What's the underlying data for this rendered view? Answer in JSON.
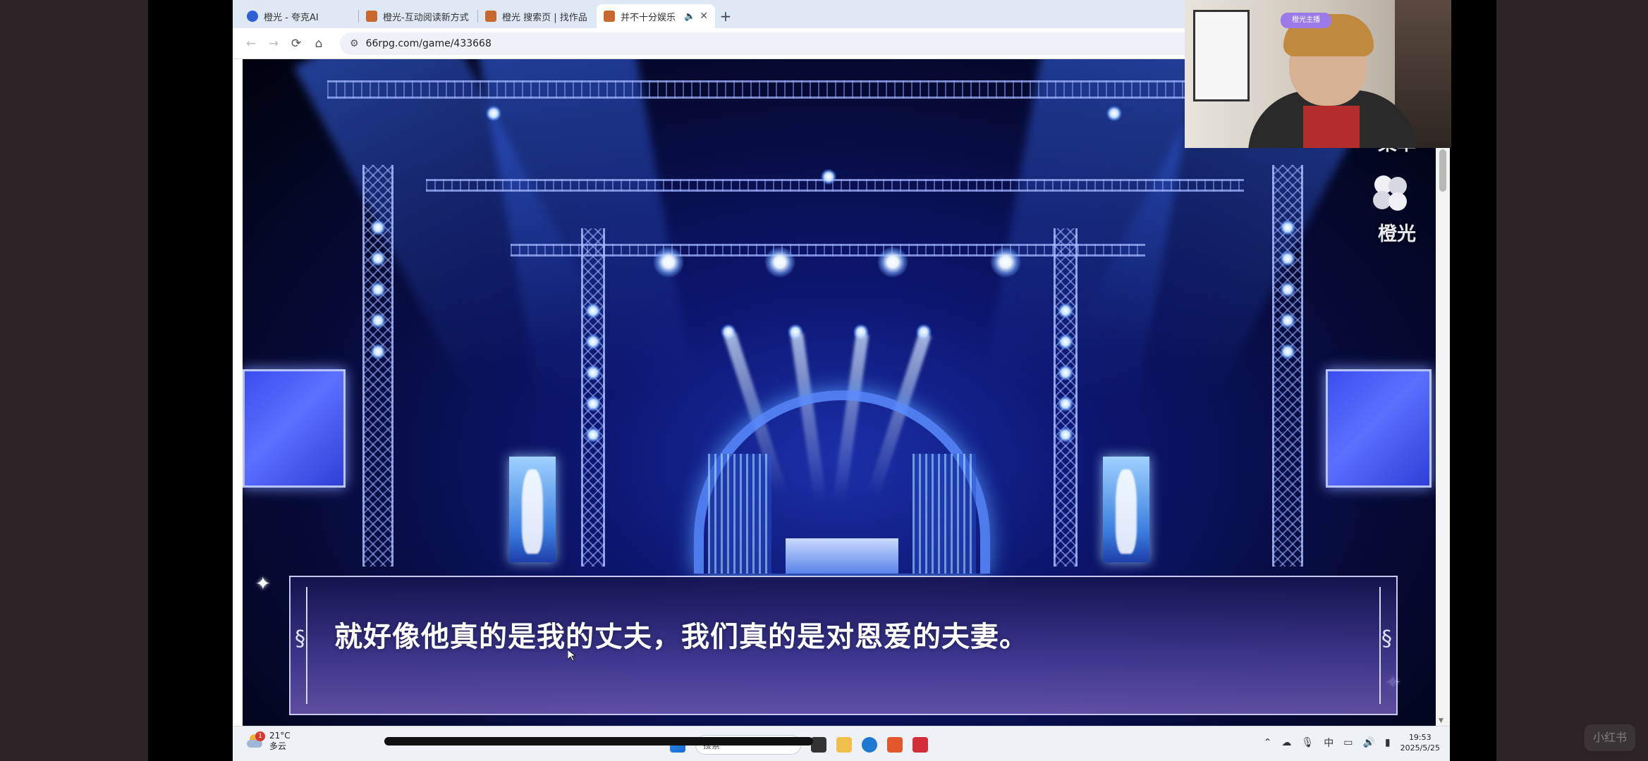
{
  "browser": {
    "tabs": [
      {
        "label": "橙光 - 夸克AI",
        "icon": "quark-icon",
        "active": false
      },
      {
        "label": "橙光-互动阅读新方式",
        "icon": "orange-light-icon",
        "active": false
      },
      {
        "label": "橙光 搜索页 | 找作品",
        "icon": "orange-light-icon",
        "active": false
      },
      {
        "label": "并不十分娱乐",
        "icon": "orange-light-icon",
        "active": true
      }
    ],
    "address": "66rpg.com/game/433668"
  },
  "game": {
    "side_menu": {
      "menu_label": "菜单",
      "brand_label": "橙光"
    },
    "dialog_text": "就好像他真的是我的丈夫，我们真的是对恩爱的夫妻。"
  },
  "taskbar": {
    "weather": {
      "temp": "21°C",
      "condition": "多云",
      "alert_count": "1"
    },
    "search_placeholder": "搜索",
    "ime": "中",
    "clock_time": "19:53",
    "clock_date": "2025/5/25"
  },
  "webcam": {
    "badge": "橙光主播"
  },
  "watermark": "小红书",
  "colors": {
    "tab_strip": "#dfe8f5",
    "stage_blue": "#1b2fa8",
    "dialog_bg": "#2a2870"
  }
}
